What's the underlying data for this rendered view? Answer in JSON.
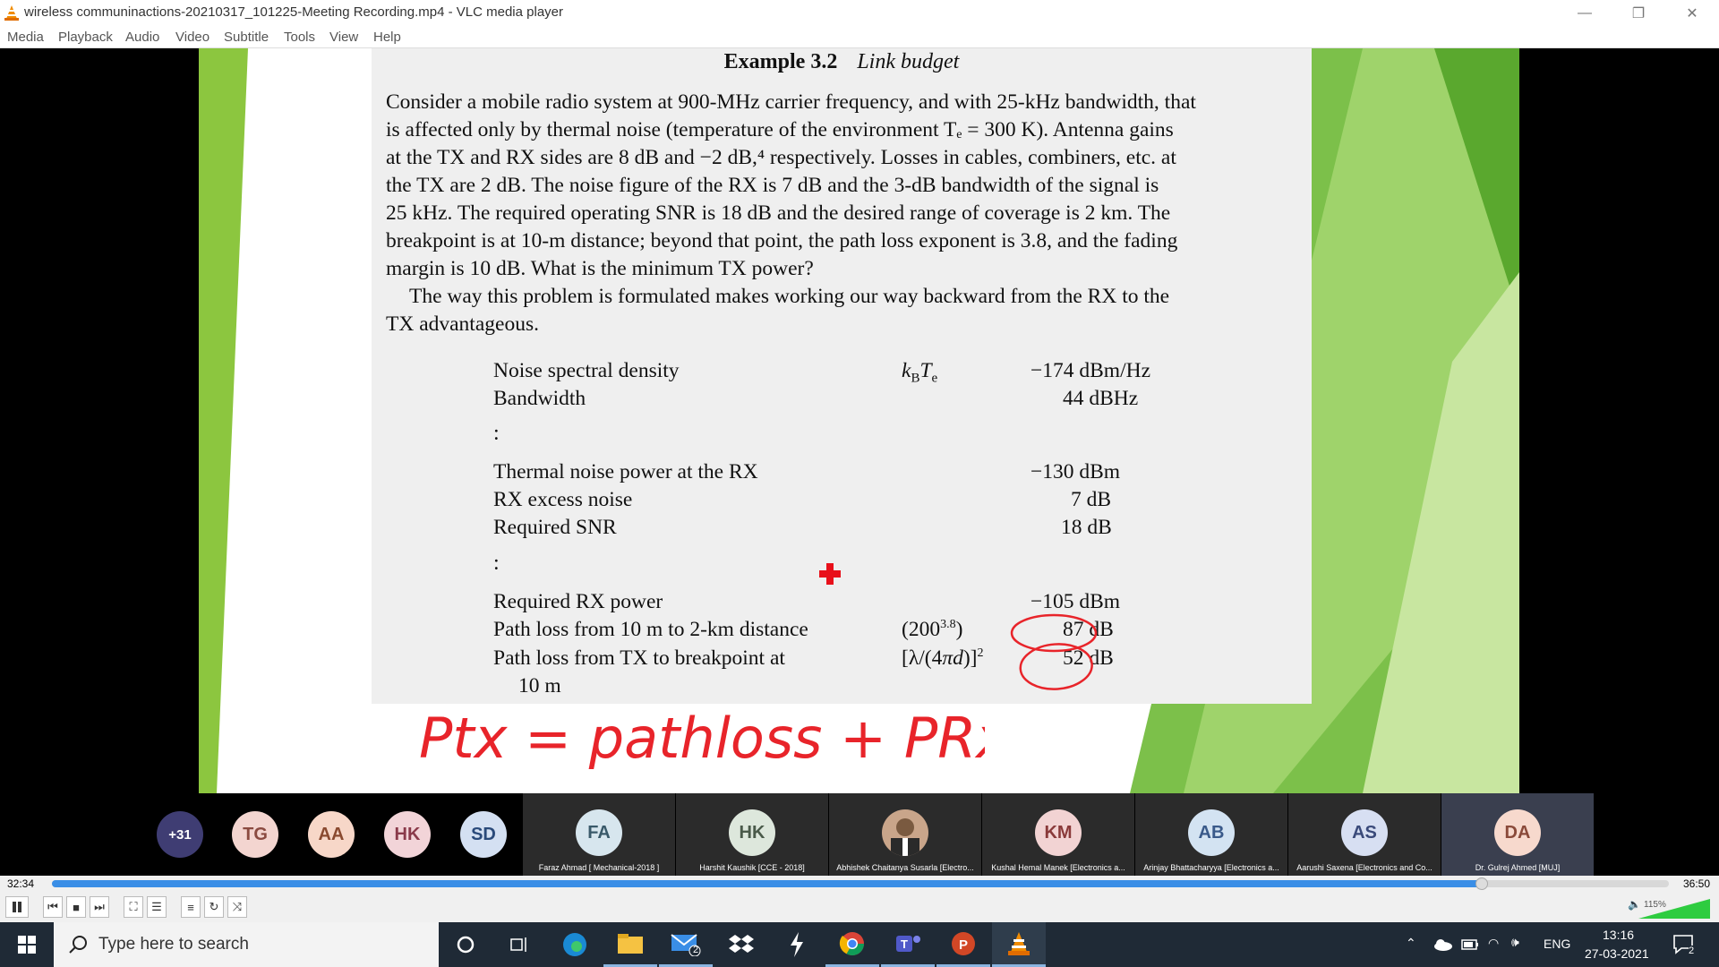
{
  "window": {
    "title": "wireless communinactions-20210317_101225-Meeting Recording.mp4 - VLC media player",
    "minimize": "—",
    "restore": "❐",
    "close": "✕"
  },
  "menu": [
    "Media",
    "Playback",
    "Audio",
    "Video",
    "Subtitle",
    "Tools",
    "View",
    "Help"
  ],
  "slide": {
    "example_number": "Example 3.2",
    "example_title": "Link budget",
    "para1_lines": [
      "Consider a mobile radio system at 900-MHz carrier frequency, and with 25-kHz bandwidth, that",
      "is affected only by thermal noise (temperature of the environment Tₑ = 300 K). Antenna gains",
      "at the TX and RX sides are 8 dB and −2 dB,⁴ respectively. Losses in cables, combiners, etc. at",
      "the TX are 2 dB. The noise figure of the RX is 7 dB and the 3-dB bandwidth of the signal is",
      "25 kHz. The required operating SNR is 18 dB and the desired range of coverage is 2 km. The",
      "breakpoint is at 10-m distance; beyond that point, the path loss exponent is 3.8, and the fading",
      "margin is 10 dB. What is the minimum TX power?"
    ],
    "para2_lines": [
      "The way this problem is formulated makes working our way backward from the RX to the",
      "TX advantageous."
    ],
    "rows": [
      {
        "label": "Noise spectral density",
        "symbol": "k_B T_e",
        "value": "−174 dBm/Hz"
      },
      {
        "label": "Bandwidth",
        "symbol": "",
        "value": "44 dBHz"
      },
      {
        "label": "Thermal noise power at the RX",
        "symbol": "",
        "value": "−130 dBm"
      },
      {
        "label": "RX excess noise",
        "symbol": "",
        "value": "7 dB"
      },
      {
        "label": "Required SNR",
        "symbol": "",
        "value": "18 dB"
      },
      {
        "label": "Required RX power",
        "symbol": "",
        "value": "−105 dBm"
      },
      {
        "label": "Path loss from 10 m to 2-km distance",
        "symbol": "(200^3.8)",
        "value": "87 dB"
      },
      {
        "label": "Path loss from TX to breakpoint at",
        "label2": "10 m",
        "symbol": "[λ/(4πd)]^2",
        "value": "52 dB"
      }
    ],
    "dots": ":",
    "handwriting": "Ptx = pathloss + PRx"
  },
  "participants": {
    "overflow": "+31",
    "bubbles": [
      {
        "initials": "TG",
        "color": "#f3d5d0"
      },
      {
        "initials": "AA",
        "color": "#f7d7c8"
      },
      {
        "initials": "HK",
        "color": "#f2d4d8"
      },
      {
        "initials": "SD",
        "color": "#d4e0f2"
      }
    ],
    "tiles": [
      {
        "initials": "FA",
        "name": "Faraz Ahmad [ Mechanical-2018 ]",
        "color": "#d7e6ee",
        "photo": false
      },
      {
        "initials": "HK",
        "name": "Harshit Kaushik [CCE - 2018]",
        "color": "#dde7dc",
        "photo": false
      },
      {
        "initials": "",
        "name": "Abhishek Chaitanya Susarla [Electro...",
        "color": "#c9a58a",
        "photo": true
      },
      {
        "initials": "KM",
        "name": "Kushal Hemal Manek [Electronics a...",
        "color": "#f2d3d3",
        "photo": false
      },
      {
        "initials": "AB",
        "name": "Arinjay Bhattacharyya [Electronics a...",
        "color": "#d3e3f2",
        "photo": false
      },
      {
        "initials": "AS",
        "name": "Aarushi Saxena [Electronics and Co...",
        "color": "#d7dff2",
        "photo": false
      },
      {
        "initials": "DA",
        "name": "Dr. Gulrej Ahmed [MUJ]",
        "color": "#f7d9cd",
        "photo": false
      }
    ]
  },
  "player": {
    "elapsed": "32:34",
    "total": "36:50",
    "progress_fraction": 0.884,
    "volume_label": "115%",
    "volume_fraction": 1.0
  },
  "taskbar": {
    "search_placeholder": "Type here to search",
    "mail_badge": "2",
    "lang": "ENG",
    "time": "13:16",
    "date": "27-03-2021",
    "notif_count": "2"
  },
  "colors": {
    "accent": "#3a8ee6",
    "ink_red": "#e8242a",
    "taskbar": "#1f2a36",
    "slide_green": "#7cc04a"
  }
}
